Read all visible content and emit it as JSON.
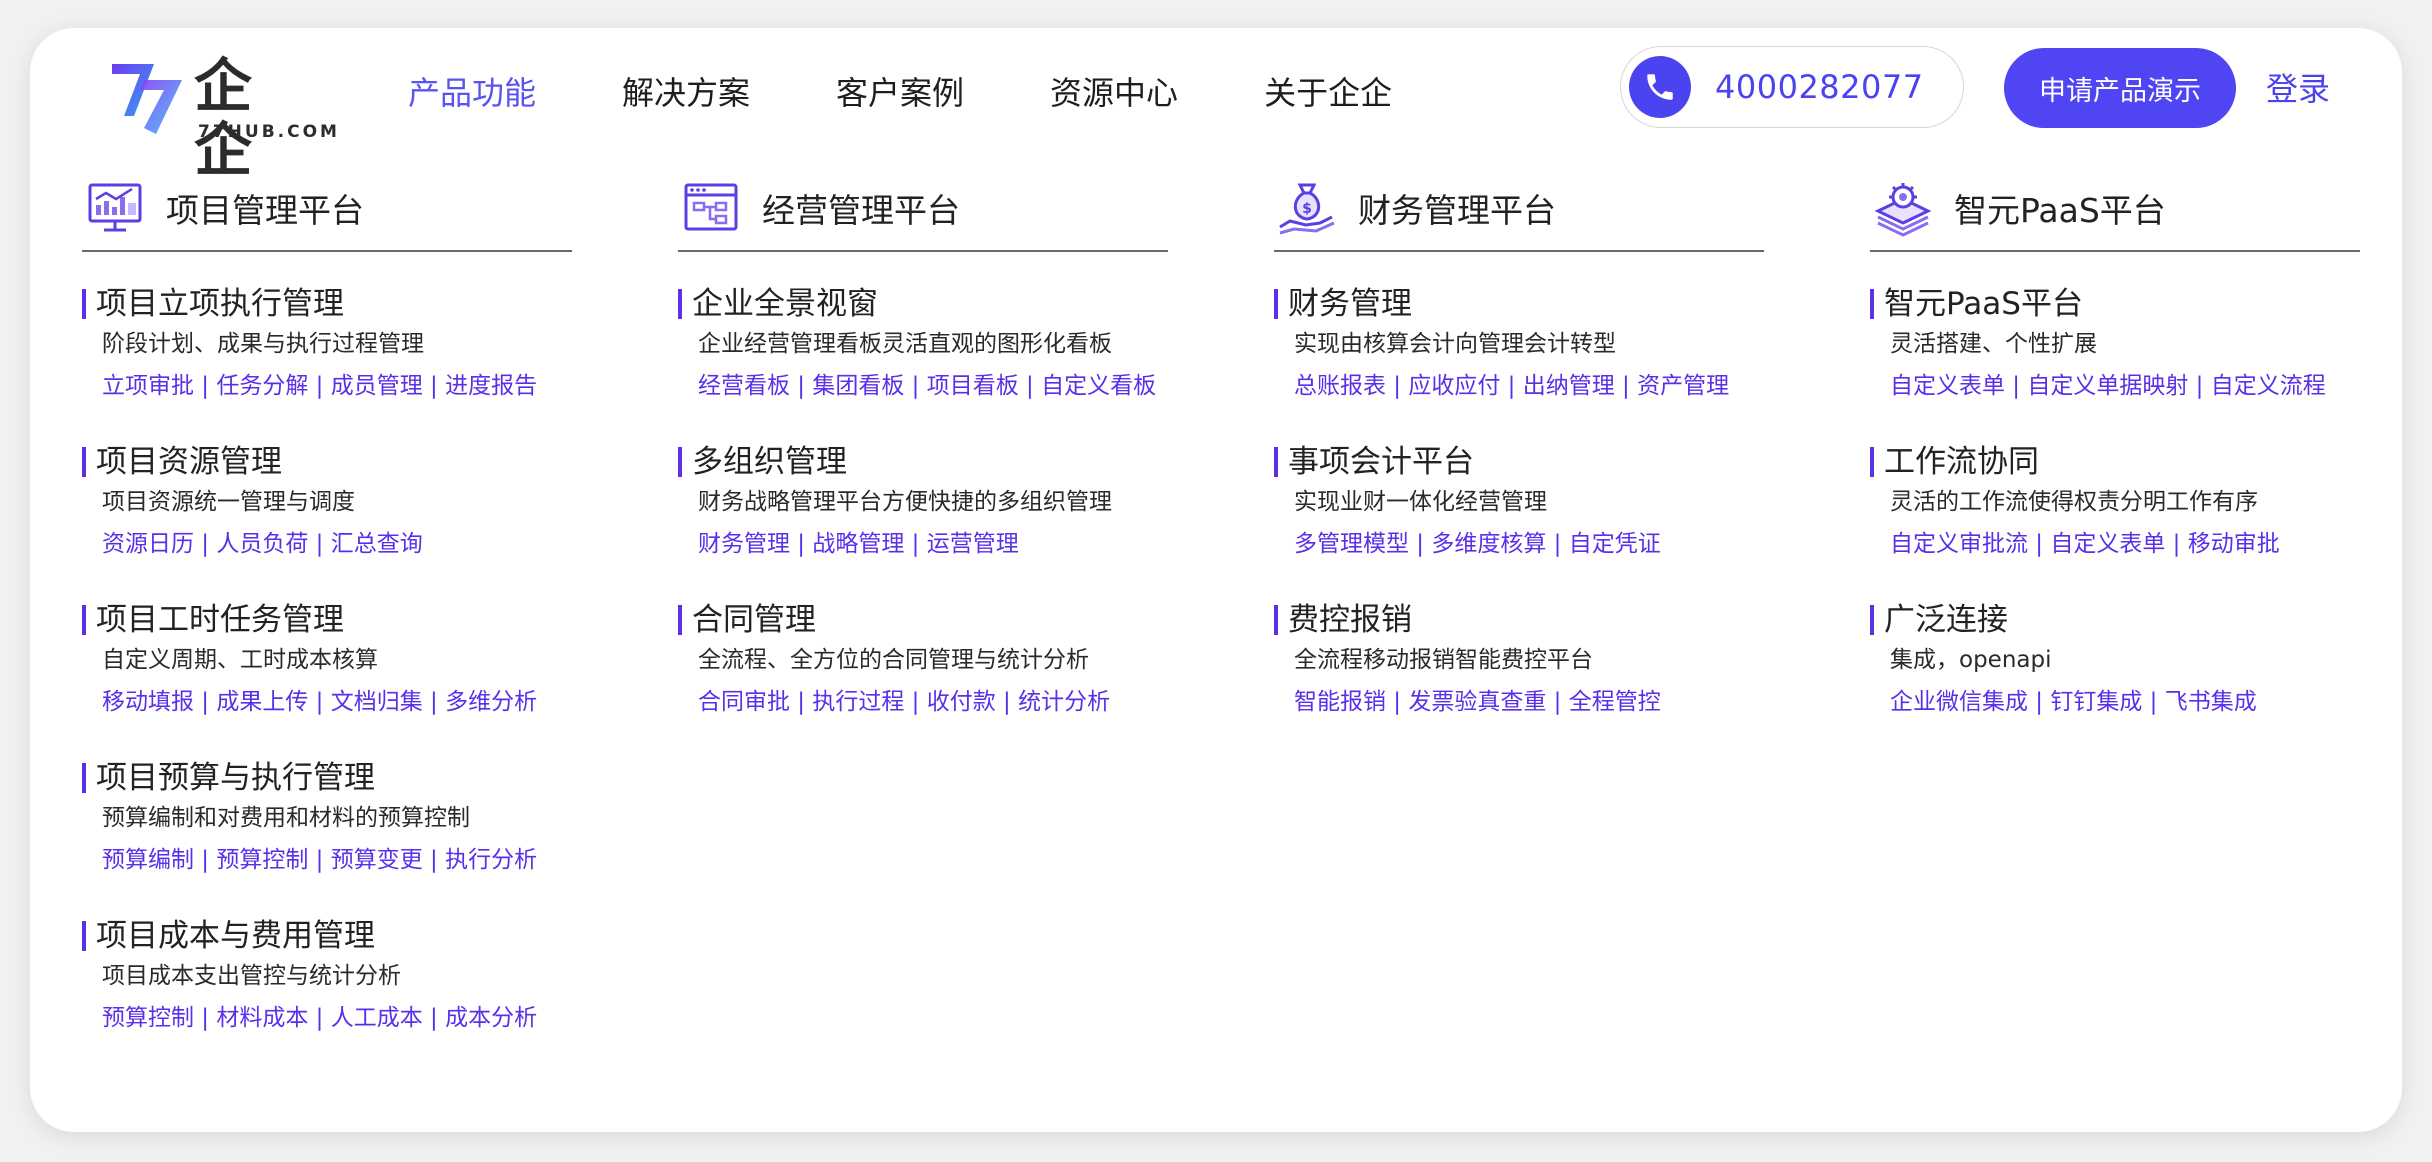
{
  "header": {
    "logo_text": "企企",
    "logo_sub": "77HUB.COM",
    "nav": [
      "产品功能",
      "解决方案",
      "客户案例",
      "资源中心",
      "关于企企"
    ],
    "active_nav_index": 0,
    "phone": "4000282077",
    "demo_button": "申请产品演示",
    "login": "登录"
  },
  "colors": {
    "accent": "#4f45f3",
    "link": "#5a2fea",
    "active_nav": "#5a53f0"
  },
  "columns": [
    {
      "title": "项目管理平台",
      "icon": "analytics-monitor-icon",
      "items": [
        {
          "title": "项目立项执行管理",
          "desc": "阶段计划、成果与执行过程管理",
          "links": [
            "立项审批",
            "任务分解",
            "成员管理",
            "进度报告"
          ]
        },
        {
          "title": "项目资源管理",
          "desc": "项目资源统一管理与调度",
          "links": [
            "资源日历",
            "人员负荷",
            "汇总查询"
          ]
        },
        {
          "title": "项目工时任务管理",
          "desc": "自定义周期、工时成本核算",
          "links": [
            "移动填报",
            "成果上传",
            "文档归集",
            "多维分析"
          ]
        },
        {
          "title": "项目预算与执行管理",
          "desc": "预算编制和对费用和材料的预算控制",
          "links": [
            "预算编制",
            "预算控制",
            "预算变更",
            "执行分析"
          ]
        },
        {
          "title": "项目成本与费用管理",
          "desc": "项目成本支出管控与统计分析",
          "links": [
            "预算控制",
            "材料成本",
            "人工成本",
            "成本分析"
          ]
        }
      ]
    },
    {
      "title": "经营管理平台",
      "icon": "flowchart-window-icon",
      "items": [
        {
          "title": "企业全景视窗",
          "desc": "企业经营管理看板灵活直观的图形化看板",
          "links": [
            "经营看板",
            "集团看板",
            "项目看板",
            "自定义看板"
          ]
        },
        {
          "title": "多组织管理",
          "desc": "财务战略管理平台方便快捷的多组织管理",
          "links": [
            "财务管理",
            "战略管理",
            "运营管理"
          ]
        },
        {
          "title": "合同管理",
          "desc": "全流程、全方位的合同管理与统计分析",
          "links": [
            "合同审批",
            "执行过程",
            "收付款",
            "统计分析"
          ]
        }
      ]
    },
    {
      "title": "财务管理平台",
      "icon": "money-bag-hand-icon",
      "items": [
        {
          "title": "财务管理",
          "desc": "实现由核算会计向管理会计转型",
          "links": [
            "总账报表",
            "应收应付",
            "出纳管理",
            "资产管理"
          ]
        },
        {
          "title": "事项会计平台",
          "desc": "实现业财一体化经营管理",
          "links": [
            "多管理模型",
            "多维度核算",
            "自定凭证"
          ]
        },
        {
          "title": "费控报销",
          "desc": "全流程移动报销智能费控平台",
          "links": [
            "智能报销",
            "发票验真查重",
            "全程管控"
          ]
        }
      ]
    },
    {
      "title": "智元PaaS平台",
      "icon": "gear-stack-icon",
      "items": [
        {
          "title": "智元PaaS平台",
          "desc": "灵活搭建、个性扩展",
          "links": [
            "自定义表单",
            "自定义单据映射",
            "自定义流程"
          ]
        },
        {
          "title": "工作流协同",
          "desc": "灵活的工作流使得权责分明工作有序",
          "links": [
            "自定义审批流",
            "自定义表单",
            "移动审批"
          ]
        },
        {
          "title": "广泛连接",
          "desc": "集成，openapi",
          "links": [
            "企业微信集成",
            "钉钉集成",
            "飞书集成"
          ]
        }
      ]
    }
  ]
}
